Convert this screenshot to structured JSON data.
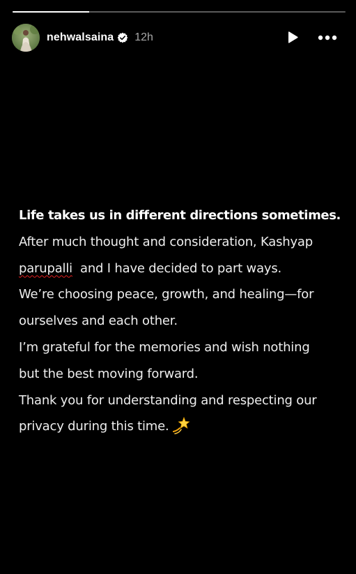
{
  "story": {
    "progress_fraction": 0.23,
    "user": {
      "username": "nehwalsaina",
      "verified": true,
      "time_ago": "12h",
      "avatar_icon": "profile-photo"
    },
    "controls": {
      "play_icon": "play-icon",
      "more_icon": "more-options-icon"
    },
    "text": {
      "heading": "Life takes us in different directions sometimes.",
      "line_2": "After much thought and consideration, Kashyap",
      "line_3_name": "parupalli",
      "line_3_rest": "and I have decided to part ways.",
      "line_4": "We’re choosing peace, growth, and healing—for",
      "line_5": "ourselves and each other.",
      "line_6": "I’m grateful for the memories and wish nothing",
      "line_7": "but the best moving forward.",
      "line_8": "Thank you for understanding and respecting our",
      "line_9": "privacy during this time.",
      "emoji_icon": "dizzy-star-emoji"
    }
  },
  "colors": {
    "background": "#000000",
    "text": "#eeeeee",
    "time": "#a8a8a8",
    "progress_track": "#5a5a5a",
    "progress_fill": "#ffffff",
    "spellcheck_underline": "#e02020"
  }
}
